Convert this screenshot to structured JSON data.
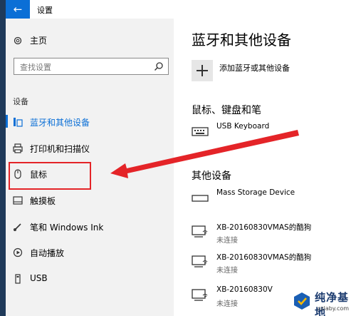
{
  "window": {
    "title": "设置"
  },
  "sidebar": {
    "home_label": "主页",
    "search_placeholder": "查找设置",
    "section_label": "设备",
    "items": [
      {
        "label": "蓝牙和其他设备",
        "icon": "bluetooth-devices-icon",
        "active": true
      },
      {
        "label": "打印机和扫描仪",
        "icon": "printer-icon"
      },
      {
        "label": "鼠标",
        "icon": "mouse-icon",
        "highlighted": true
      },
      {
        "label": "触摸板",
        "icon": "touchpad-icon"
      },
      {
        "label": "笔和 Windows Ink",
        "icon": "pen-icon"
      },
      {
        "label": "自动播放",
        "icon": "autoplay-icon"
      },
      {
        "label": "USB",
        "icon": "usb-icon"
      }
    ]
  },
  "main": {
    "title": "蓝牙和其他设备",
    "add_label": "添加蓝牙或其他设备",
    "section_input": "鼠标、键盘和笔",
    "input_devices": [
      {
        "name": "USB Keyboard",
        "icon": "keyboard-icon"
      }
    ],
    "section_other": "其他设备",
    "other_devices": [
      {
        "name": "Mass Storage Device",
        "icon": "storage-device-icon",
        "status": ""
      },
      {
        "name": "XB-20160830VMAS的酷狗",
        "icon": "network-device-icon",
        "status": "未连接"
      },
      {
        "name": "XB-20160830VMAS的酷狗",
        "icon": "network-device-icon",
        "status": "未连接"
      },
      {
        "name": "XB-20160830V",
        "icon": "network-device-icon",
        "status": "未连接"
      }
    ]
  },
  "annotation": {
    "arrow_color": "#e42428",
    "box_color": "#e42428"
  },
  "watermark": {
    "text": "纯净基地",
    "sub": "czlaby.com"
  },
  "colors": {
    "accent": "#0b6fd6",
    "sidebar_bg": "#f2f2f2"
  }
}
